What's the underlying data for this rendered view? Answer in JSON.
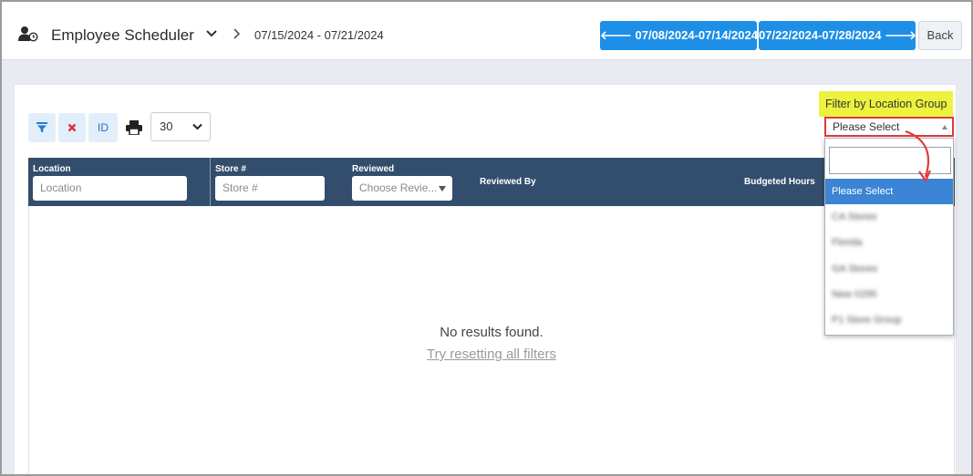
{
  "header": {
    "title": "Employee Scheduler",
    "date_range": "07/15/2024 - 07/21/2024",
    "prev_week": "07/08/2024-07/14/2024",
    "next_week": "07/22/2024-07/28/2024",
    "back": "Back"
  },
  "toolbar": {
    "id_label": "ID",
    "page_size": "30"
  },
  "filter": {
    "label": "Filter by Location Group",
    "selected": "Please Select",
    "options": [
      "Please Select",
      "CA Stores",
      "Florida",
      "GA Stores",
      "New 0295",
      "P1 Store Group"
    ]
  },
  "table": {
    "columns": {
      "location": "Location",
      "store": "Store #",
      "reviewed": "Reviewed",
      "reviewed_by": "Reviewed By",
      "budgeted_hours": "Budgeted Hours"
    },
    "placeholders": {
      "location": "Location",
      "store": "Store #",
      "reviewed": "Choose Revie..."
    },
    "empty_message": "No results found.",
    "reset_link": "Try resetting all filters"
  },
  "colors": {
    "primary_button": "#1e8fe6",
    "table_header": "#334e6c",
    "highlight": "#ecf23d",
    "annotation_red": "#e0393a",
    "selected_option": "#3b84d6"
  }
}
